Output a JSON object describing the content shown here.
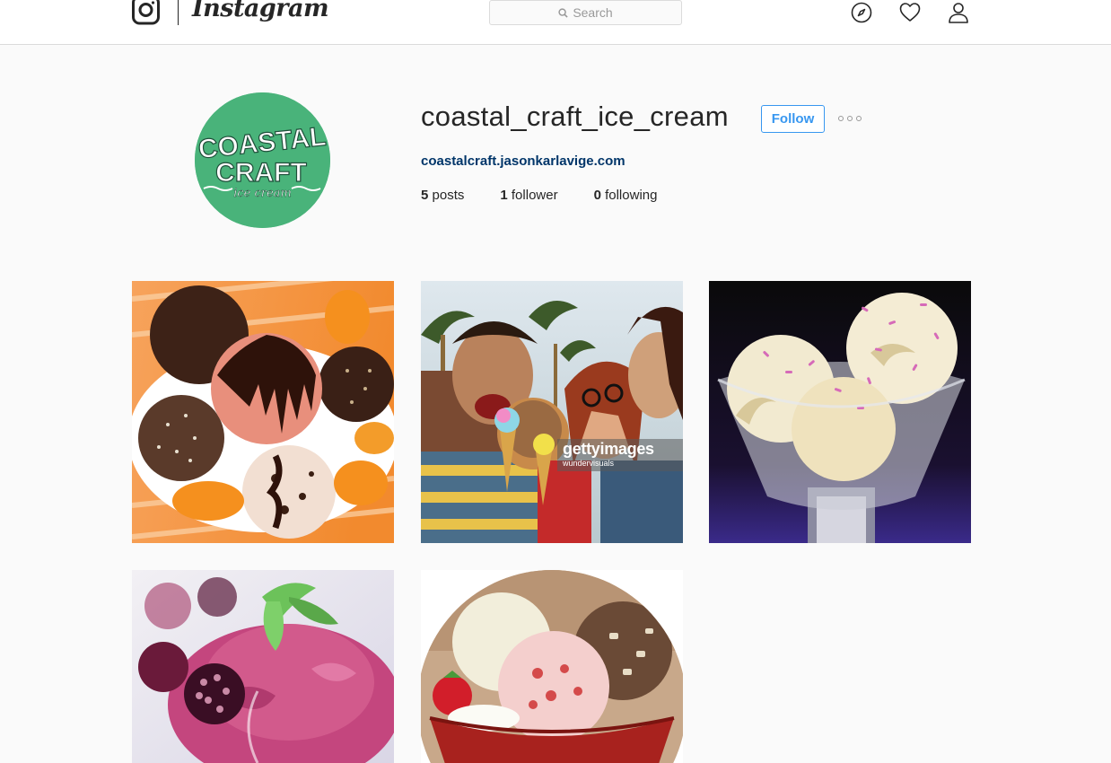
{
  "nav": {
    "brand": "Instagram",
    "search_placeholder": "Search"
  },
  "profile": {
    "username": "coastal_craft_ice_cream",
    "follow_label": "Follow",
    "website": "coastalcraft.jasonkarlavige.com",
    "avatar_text": {
      "line1": "COASTAL",
      "line2": "CRAFT",
      "line3": "ice cream"
    },
    "stats": {
      "posts_count": "5",
      "posts_label": "posts",
      "followers_count": "1",
      "followers_label": "follower",
      "following_count": "0",
      "following_label": "following"
    }
  },
  "posts": [
    {
      "alt": "chocolate and coconut ice cream scoops with mandarin slices"
    },
    {
      "alt": "friends licking ice cream cones",
      "watermark": "gettyimages",
      "watermark_sub": "wundervisuals"
    },
    {
      "alt": "vanilla ice cream with pink sprinkles in glass"
    },
    {
      "alt": "berry sorbet with blackberries and mint"
    },
    {
      "alt": "three ice cream scoops in red bowl"
    }
  ],
  "colors": {
    "accent": "#3897f0",
    "link": "#003569",
    "avatar_bg": "#49b37a"
  }
}
